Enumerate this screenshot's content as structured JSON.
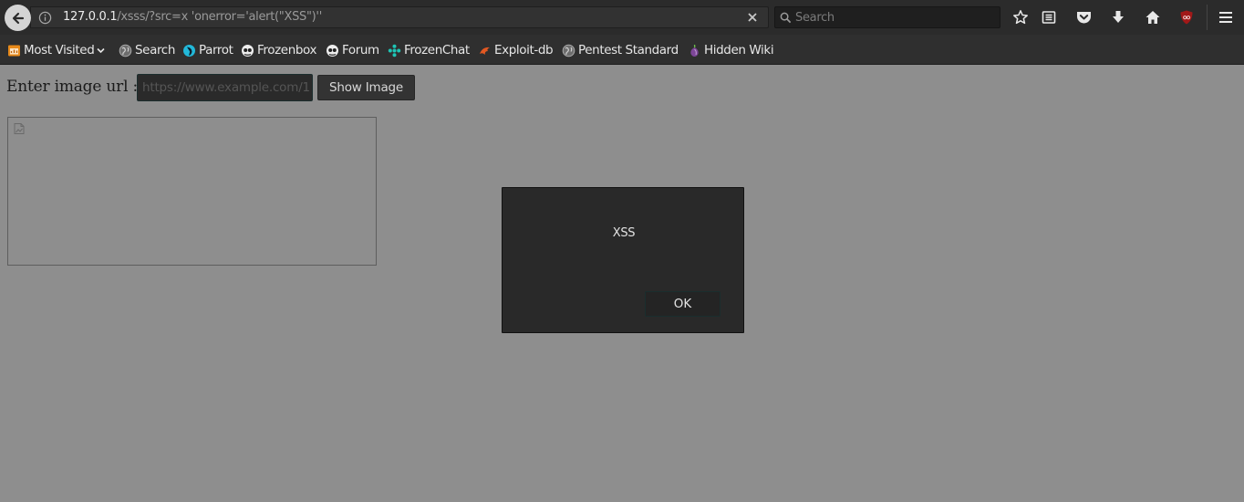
{
  "toolbar": {
    "url_host": "127.0.0.1",
    "url_path": "/xsss/?src=x 'onerror='alert(\"XSS\")''",
    "search_placeholder": "Search"
  },
  "bookmarks": [
    {
      "label": "Most Visited",
      "icon": "most-visited-icon"
    },
    {
      "label": "Search",
      "icon": "globe-icon"
    },
    {
      "label": "Parrot",
      "icon": "parrot-icon"
    },
    {
      "label": "Frozenbox",
      "icon": "frozenbox-icon"
    },
    {
      "label": "Forum",
      "icon": "forum-icon"
    },
    {
      "label": "FrozenChat",
      "icon": "frozenchat-icon"
    },
    {
      "label": "Exploit-db",
      "icon": "exploit-db-icon"
    },
    {
      "label": "Pentest Standard",
      "icon": "globe-icon"
    },
    {
      "label": "Hidden Wiki",
      "icon": "onion-icon"
    }
  ],
  "page": {
    "label": "Enter image url :",
    "input_placeholder": "https://www.example.com/1",
    "button_label": "Show Image"
  },
  "dialog": {
    "message": "XSS",
    "ok_label": "OK"
  },
  "colors": {
    "toolbar_bg": "#2b2b2b",
    "page_bg": "#8e8e8e",
    "dialog_bg": "#292929",
    "ublock_red": "#a11818"
  }
}
